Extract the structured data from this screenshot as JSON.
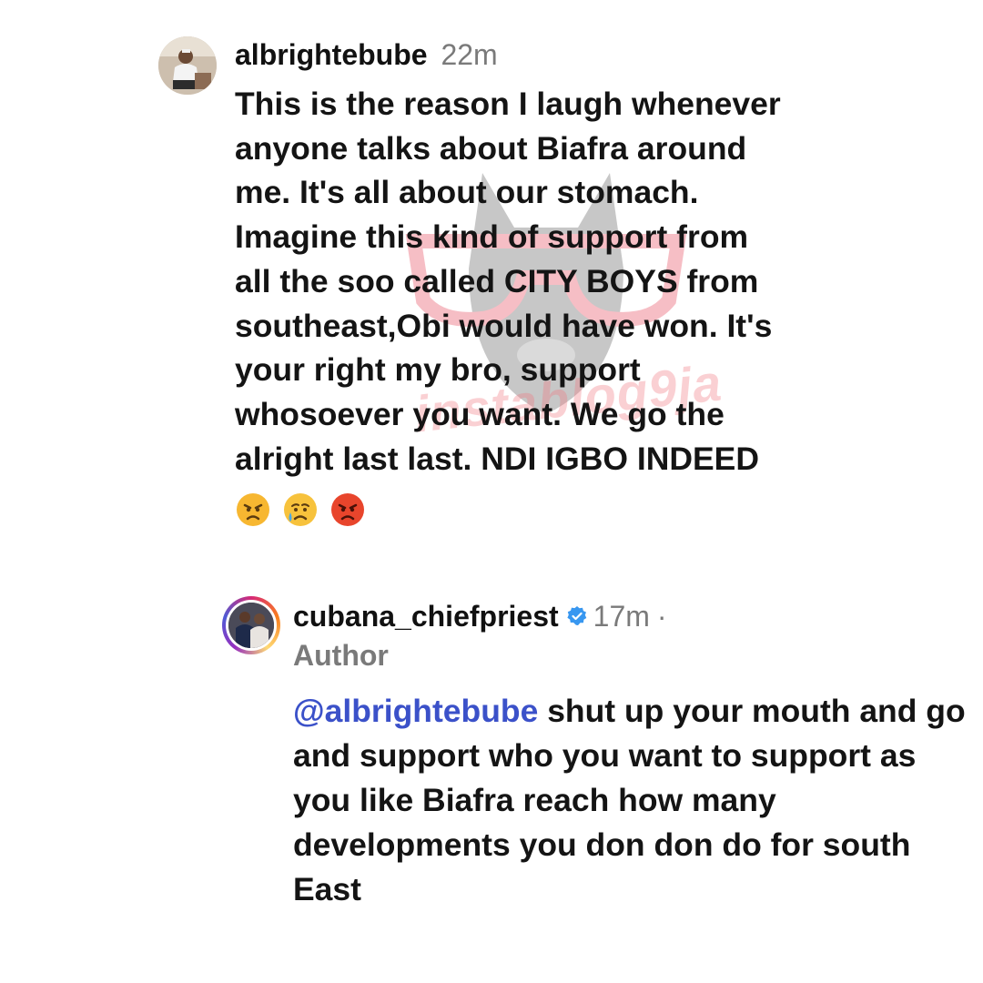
{
  "comment": {
    "username": "albrightebube",
    "time": "22m",
    "text": "This is the reason I laugh whenever\nanyone talks about Biafra  around\nme. It's all about our stomach.\nImagine this kind of support from\nall the soo called CITY BOYS from\nsoutheast,Obi would have won. It's\nyour right my bro, support\nwhosoever you want. We go the\nalright last last.  NDI IGBO INDEED",
    "emojis": [
      "angry-face-icon",
      "crying-face-icon",
      "pouting-face-icon"
    ]
  },
  "reply": {
    "username": "cubana_chiefpriest",
    "time": "17m",
    "separator": "·",
    "author_label": "Author",
    "mention": "@albrightebube",
    "text": " shut up your mouth and go and support who you want to support as you like Biafra reach how many developments you don don do for south East"
  },
  "watermark": {
    "text": "instablog9ja"
  },
  "colors": {
    "mention": "#3b51c9",
    "verified": "#3897f0",
    "muted": "#7a7a7a"
  }
}
